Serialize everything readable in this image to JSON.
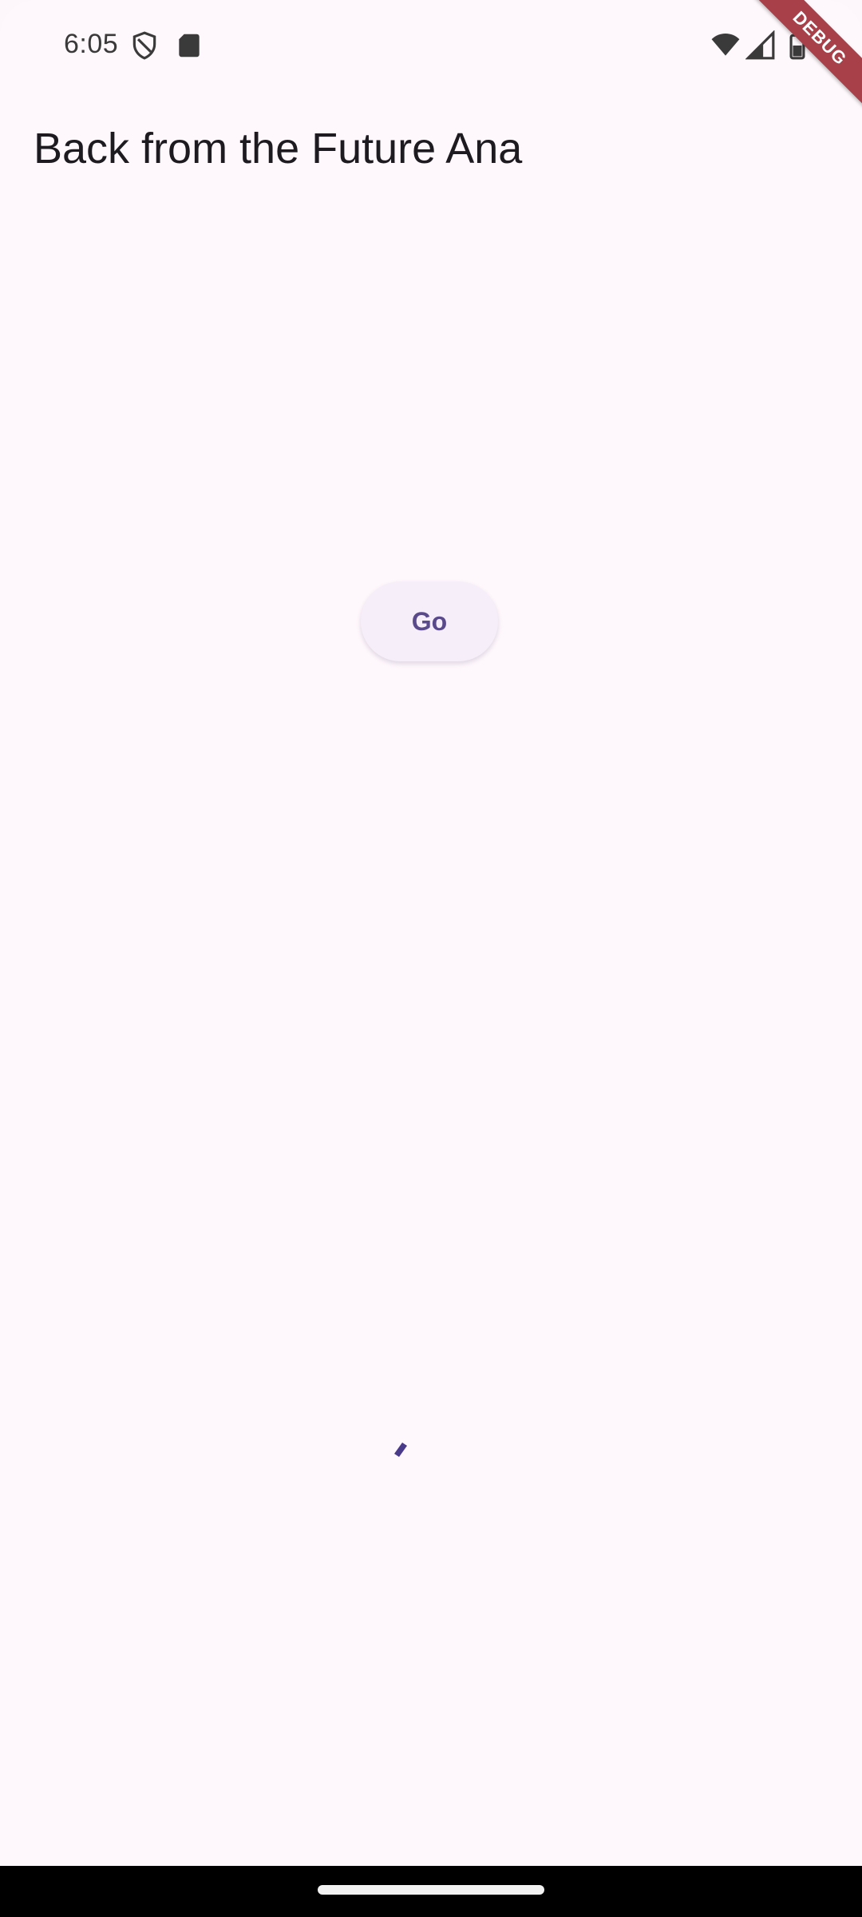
{
  "status_bar": {
    "time": "6:05",
    "icons": [
      "shield-icon",
      "sd-card-icon",
      "wifi-icon",
      "cell-signal-icon",
      "battery-icon"
    ]
  },
  "debug_banner": "DEBUG",
  "app_bar": {
    "title": "Back from the Future Ana"
  },
  "main": {
    "go_button_label": "Go",
    "progress_indicator": "loading"
  },
  "colors": {
    "background": "#fef7fb",
    "button_text": "#5a4a8c",
    "button_bg": "#f6eef8",
    "spinner": "#4a3a8a",
    "debug_ribbon": "#a8404a"
  }
}
